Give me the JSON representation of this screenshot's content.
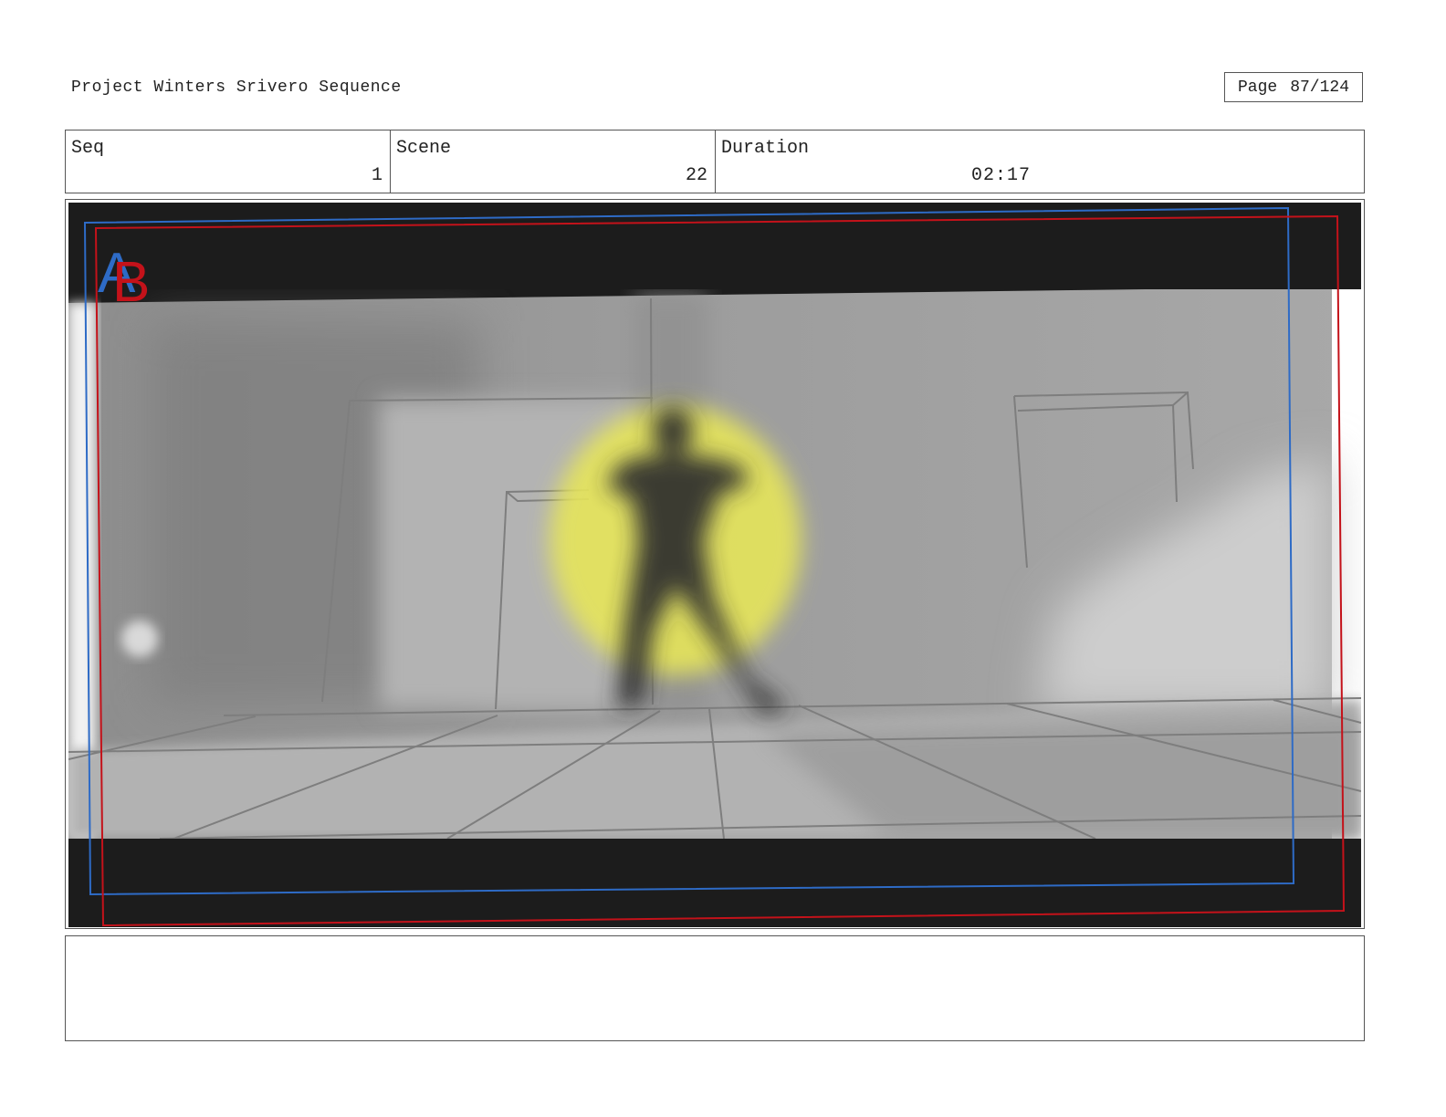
{
  "header": {
    "project_title": "Project Winters Srivero Sequence",
    "page_label": "Page",
    "page_value": "87/124"
  },
  "info": {
    "seq_label": "Seq",
    "seq_value": "1",
    "scene_label": "Scene",
    "scene_value": "22",
    "duration_label": "Duration",
    "duration_value": "02:17"
  },
  "frame": {
    "marker_a": "A",
    "marker_b": "B",
    "color_a": "#2e6bc6",
    "color_b": "#c4121a",
    "highlight": "#e6e55a"
  },
  "notes": {
    "text": ""
  }
}
